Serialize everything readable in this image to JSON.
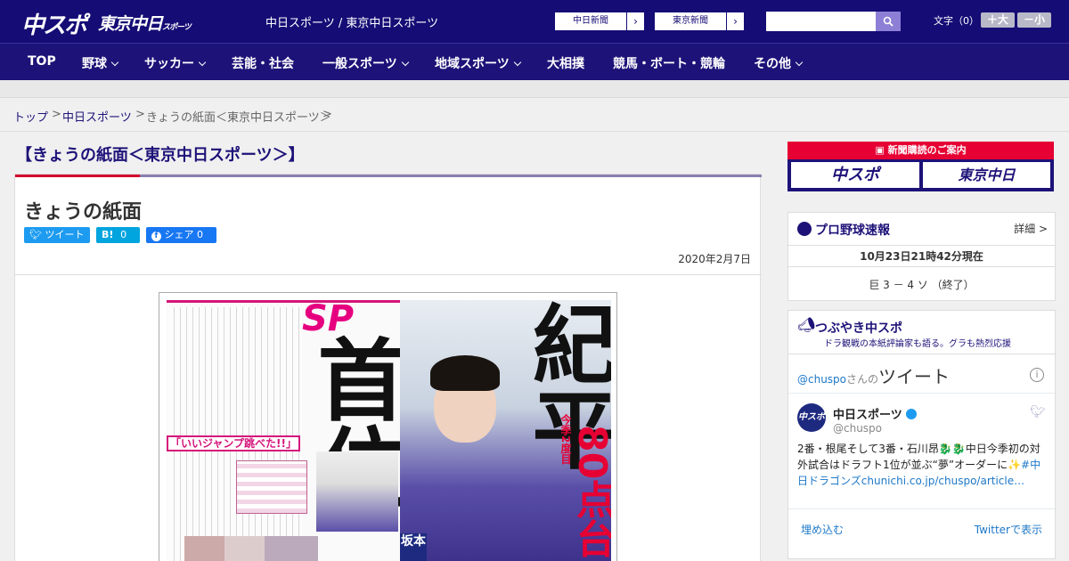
{
  "header": {
    "logo_main": "中スポ",
    "logo_tokyo": "東京中日",
    "logo_tokyo_small": "スポーツ",
    "site_title": "中日スポーツ / 東京中日スポーツ",
    "btn_chunichi": "中日新聞",
    "btn_tokyo": "東京新聞",
    "search_placeholder": "",
    "fontsize_label": "文字（0）",
    "font_bigger": "＋大",
    "font_smaller": "－小"
  },
  "nav": [
    {
      "label": "TOP",
      "has_menu": false
    },
    {
      "label": "野球",
      "has_menu": true
    },
    {
      "label": "サッカー",
      "has_menu": true
    },
    {
      "label": "芸能・社会",
      "has_menu": false
    },
    {
      "label": "一般スポーツ",
      "has_menu": true
    },
    {
      "label": "地域スポーツ",
      "has_menu": true
    },
    {
      "label": "大相撲",
      "has_menu": false
    },
    {
      "label": "競馬・ボート・競輪",
      "has_menu": false
    },
    {
      "label": "その他",
      "has_menu": true
    }
  ],
  "breadcrumb": {
    "top": "トップ",
    "sep1": ">",
    "chunichi": "中日スポーツ",
    "sep2": ">",
    "current": "きょうの紙面＜東京中日スポーツ＞",
    "sep3": ">"
  },
  "main": {
    "page_heading": "【きょうの紙面＜東京中日スポーツ＞】",
    "article_title": "きょうの紙面",
    "share": {
      "tweet": "ツイート",
      "hatena": "B!",
      "hatena_count": "0",
      "facebook": "シェア",
      "facebook_count": "0"
    },
    "date": "2020年2月7日",
    "paper": {
      "headline_sp": "SP",
      "headline_left": "首位",
      "headline_right": "紀平",
      "sub_right": "今季2度目",
      "score": "80点台",
      "quote": "「いいジャンプ跳べた!!」",
      "tag": "坂本"
    }
  },
  "sidebar": {
    "subscribe": {
      "banner": "新聞購読のご案内",
      "logo_a": "中スポ",
      "logo_b": "東京中日"
    },
    "baseball": {
      "title": "プロ野球速報",
      "more": "詳細 >",
      "time": "10月23日21時42分現在",
      "score": "巨 3 － 4 ソ （終了）"
    },
    "twitter": {
      "title": "つぶやき中スポ",
      "subtitle": "ドラ観戦の本紙評論家も語る。グラも熱烈応援",
      "handle_link": "@chuspo",
      "handle_suffix": "さんの",
      "tweet_word": "ツイート",
      "account_name": "中日スポーツ",
      "account_handle": "@chuspo",
      "tweet_text_a": "2番・根尾そして3番・石川昂🐉🐉中日今季初の対外試合はドラフト1位が並ぶ“夢”オーダーに✨",
      "tweet_text_b": "#中日ドラゴンズ",
      "tweet_text_c": "chunichi.co.jp/chuspo/article…",
      "embed": "埋め込む",
      "view_on_twitter": "Twitterで表示"
    }
  },
  "colors": {
    "brand_navy": "#150c75",
    "accent_red": "#e60033",
    "link_blue": "#1d78c8"
  }
}
